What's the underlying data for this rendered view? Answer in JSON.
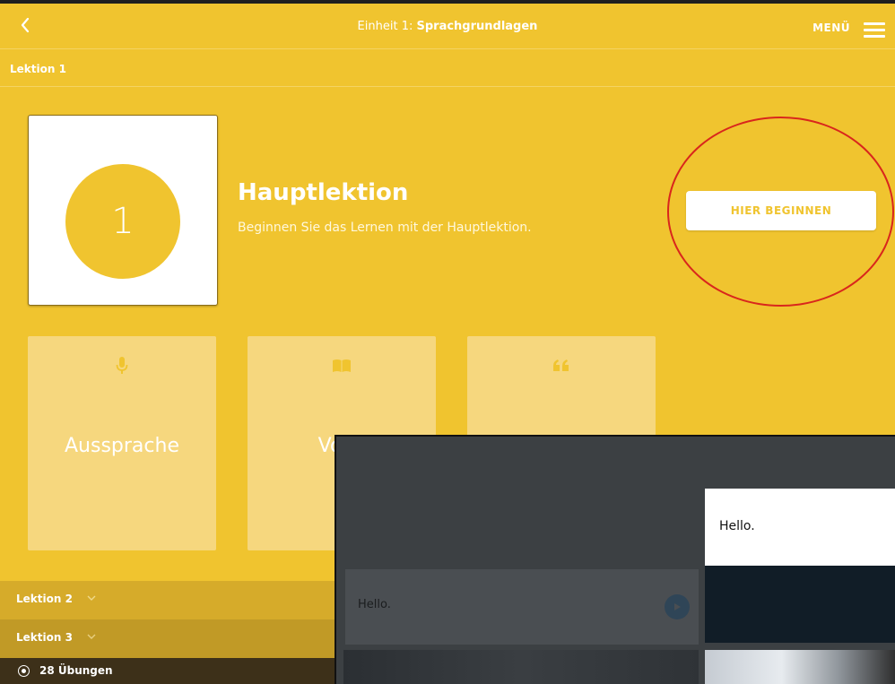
{
  "header": {
    "title_prefix": "Einheit 1:",
    "title_bold": "Sprachgrundlagen",
    "menu_label": "MENÜ"
  },
  "lesson": {
    "header": "Lektion 1",
    "number": "1",
    "title": "Hauptlektion",
    "subtitle": "Beginnen Sie das Lernen mit der Hauptlektion.",
    "start_button": "HIER BEGINNEN"
  },
  "tiles": [
    {
      "label": "Aussprache",
      "icon": "microphone-icon"
    },
    {
      "label": "Voka",
      "icon": "book-icon"
    },
    {
      "label": "",
      "icon": "quote-icon"
    }
  ],
  "lessons_list": [
    {
      "label": "Lektion 2"
    },
    {
      "label": "Lektion 3"
    }
  ],
  "exercises": {
    "count_label": "28 Übungen"
  },
  "overlay": {
    "left_text": "Hello.",
    "right_text": "Hello."
  },
  "colors": {
    "accent": "#f0c42f",
    "annotation": "#d9261c"
  }
}
